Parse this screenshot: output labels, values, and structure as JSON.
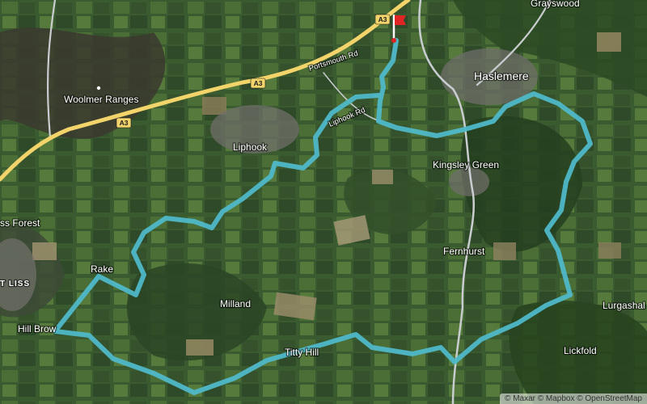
{
  "map": {
    "type": "satellite-route",
    "route_color": "#4fb8c8",
    "motorway_color": "#f2d46b",
    "minor_road_color": "#cfd3d6",
    "flag_color": "#e02424",
    "places": [
      {
        "id": "grayswood",
        "label": "Grayswood"
      },
      {
        "id": "haslemere",
        "label": "Haslemere"
      },
      {
        "id": "woolmer-ranges",
        "label": "Woolmer Ranges"
      },
      {
        "id": "liphook",
        "label": "Liphook"
      },
      {
        "id": "kingsley-green",
        "label": "Kingsley Green"
      },
      {
        "id": "liss-forest",
        "label": "ss Forest"
      },
      {
        "id": "fernhurst",
        "label": "Fernhurst"
      },
      {
        "id": "rake",
        "label": "Rake"
      },
      {
        "id": "liss",
        "label": "T LISS"
      },
      {
        "id": "milland",
        "label": "Milland"
      },
      {
        "id": "lurgashall",
        "label": "Lurgashal"
      },
      {
        "id": "hill-brow",
        "label": "Hill Brow"
      },
      {
        "id": "titty-hill",
        "label": "Titty Hill"
      },
      {
        "id": "lickfold",
        "label": "Lickfold"
      }
    ],
    "roads": {
      "portsmouth_rd": "Portsmouth Rd",
      "liphook_rd": "Liphook Rd",
      "a3_shield": "A3"
    },
    "start_marker": "flag-icon",
    "attribution": "© Maxar © Mapbox © OpenStreetMap"
  }
}
